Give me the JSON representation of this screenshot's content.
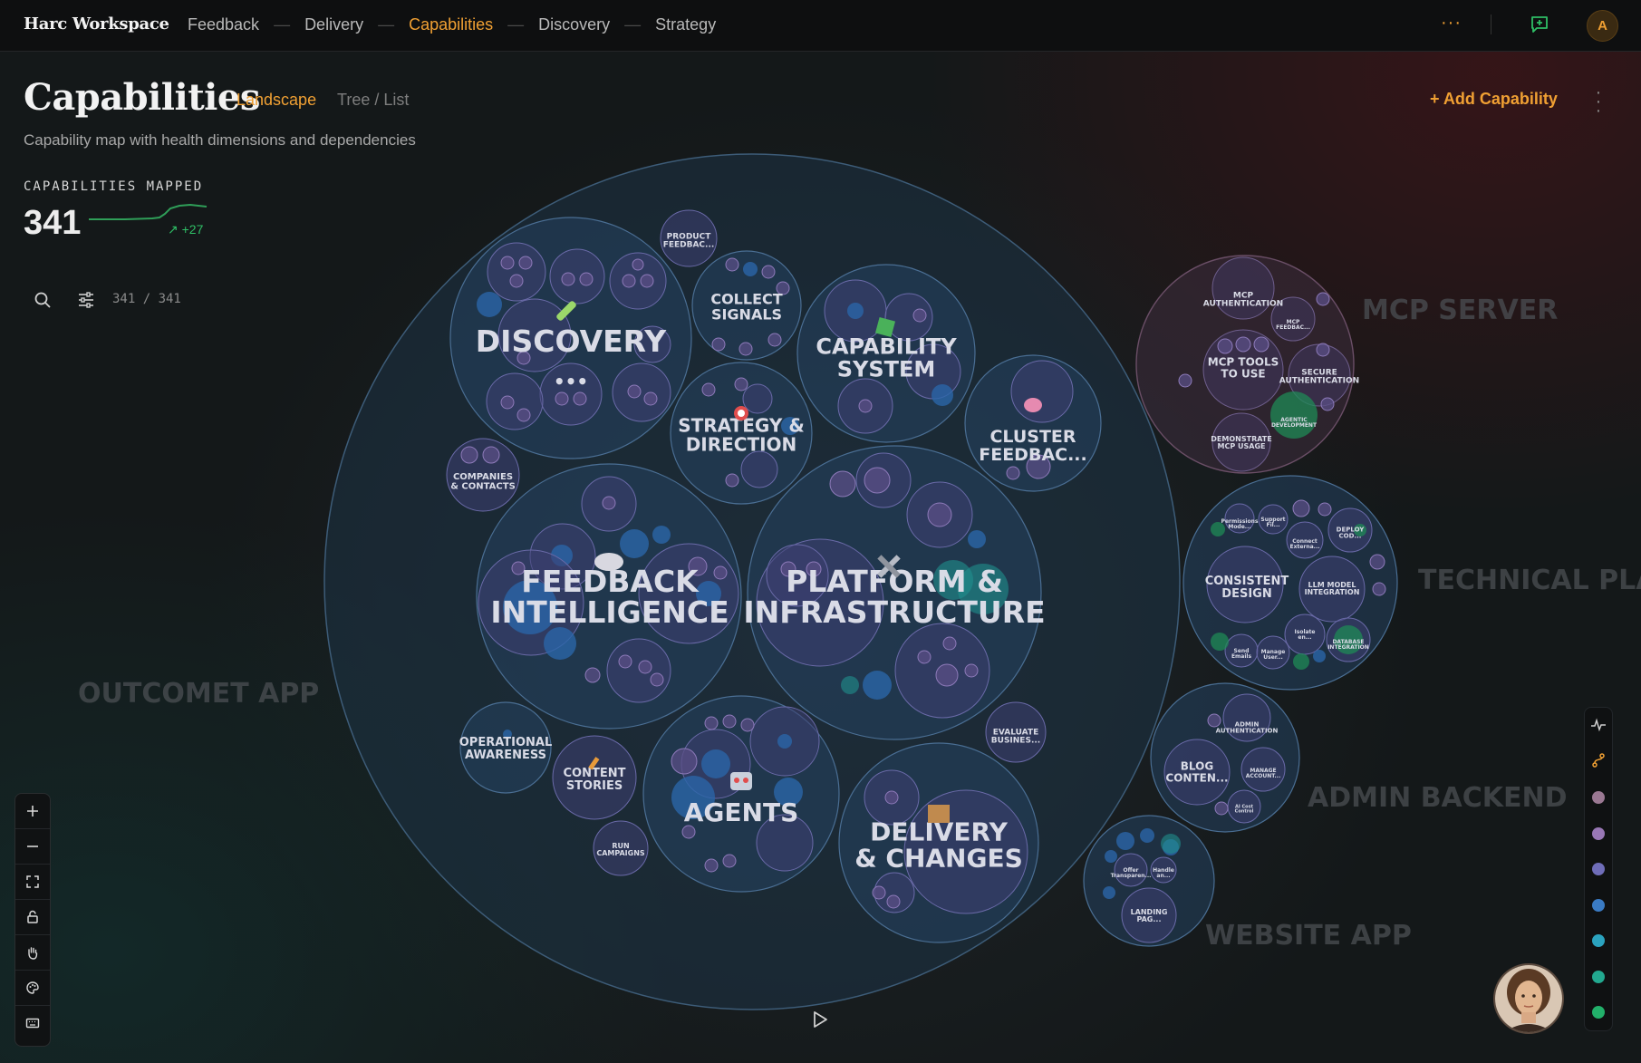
{
  "topbar": {
    "brand": "Harc Workspace",
    "nav": [
      {
        "label": "Feedback",
        "active": false
      },
      {
        "label": "Delivery",
        "active": false
      },
      {
        "label": "Capabilities",
        "active": true
      },
      {
        "label": "Discovery",
        "active": false
      },
      {
        "label": "Strategy",
        "active": false
      }
    ],
    "more_label": "···",
    "avatar_initial": "A",
    "accent_color": "#f0a033"
  },
  "header": {
    "title": "Capabilities",
    "view_tabs": [
      "Landscape",
      "Tree / List"
    ],
    "active_view": "Landscape",
    "subtitle": "Capability map with health dimensions and dependencies",
    "add_button": "+ Add Capability",
    "menu_icon": "kebab-icon"
  },
  "metric": {
    "label": "CAPABILITIES MAPPED",
    "value": "341",
    "delta": "↗ +27"
  },
  "filter_bar": {
    "count": "341 / 341",
    "icons": [
      "search-icon",
      "filter-icon"
    ]
  },
  "map": {
    "groups": [
      "OUTCOMET APP",
      "MCP SERVER",
      "TECHNICAL PLATFORM",
      "ADMIN BACKEND",
      "WEBSITE APP"
    ],
    "capabilities": {
      "discovery": "DISCOVERY",
      "collect_signals": "COLLECT SIGNALS",
      "product_feedback": "PRODUCT FEEDBAC...",
      "capability_system": "CAPABILITY SYSTEM",
      "strategy_direction": "STRATEGY & DIRECTION",
      "cluster_feedback": "CLUSTER FEEDBAC...",
      "companies_contacts": "COMPANIES & CONTACTS",
      "feedback_intelligence": "FEEDBACK INTELLIGENCE",
      "platform_infrastructure": "PLATFORM & INFRASTRUCTURE",
      "operational_awareness": "OPERATIONAL AWARENESS",
      "content_stories": "CONTENT STORIES",
      "agents": "AGENTS",
      "evaluate_business": "EVALUATE BUSINES...",
      "run_campaigns": "RUN CAMPAIGNS",
      "delivery_changes": "DELIVERY & CHANGES",
      "mcp_authentication": "MCP AUTHENTICATION",
      "mcp_feedback": "MCP FEEDBAC...",
      "mcp_tools": "MCP TOOLS TO USE",
      "secure_authentication": "SECURE AUTHENTICATION",
      "agentic_development": "AGENTIC DEVELOPMENT",
      "demonstrate_mcp": "DEMONSTRATE MCP USAGE",
      "permissions_mode": "Permissions Mode...",
      "support_fil": "Support Fil...",
      "connect_externa": "Connect Externa...",
      "deploy_cod": "DEPLOY COD...",
      "consistent_design": "CONSISTENT DESIGN",
      "llm_model_integration": "LLM MODEL INTEGRATION",
      "isolate_en": "Isolate en...",
      "send_emails": "Send Emails",
      "manage_user": "Manage User...",
      "database_integration": "DATABASE INTEGRATION",
      "admin_authentication": "ADMIN AUTHENTICATION",
      "blog_content": "BLOG CONTEN...",
      "manage_account": "MANAGE ACCOUNT...",
      "ai_cost_control": "AI Cost Control",
      "offer_transparen": "Offer Transparen...",
      "handle_an": "Handle an...",
      "landing_page": "LANDING PAG..."
    }
  },
  "controls": [
    "zoom-in-icon",
    "zoom-out-icon",
    "fit-screen-icon",
    "lock-icon",
    "hand-icon",
    "palette-icon",
    "keyboard-icon"
  ],
  "legend": {
    "icons": [
      "pulse-icon",
      "branch-icon"
    ],
    "colors": [
      "#9a7892",
      "#9877b5",
      "#6f6db8",
      "#3a7bc4",
      "#2ba3bf",
      "#22a88f",
      "#22b06a"
    ]
  },
  "play_icon": "play-icon"
}
